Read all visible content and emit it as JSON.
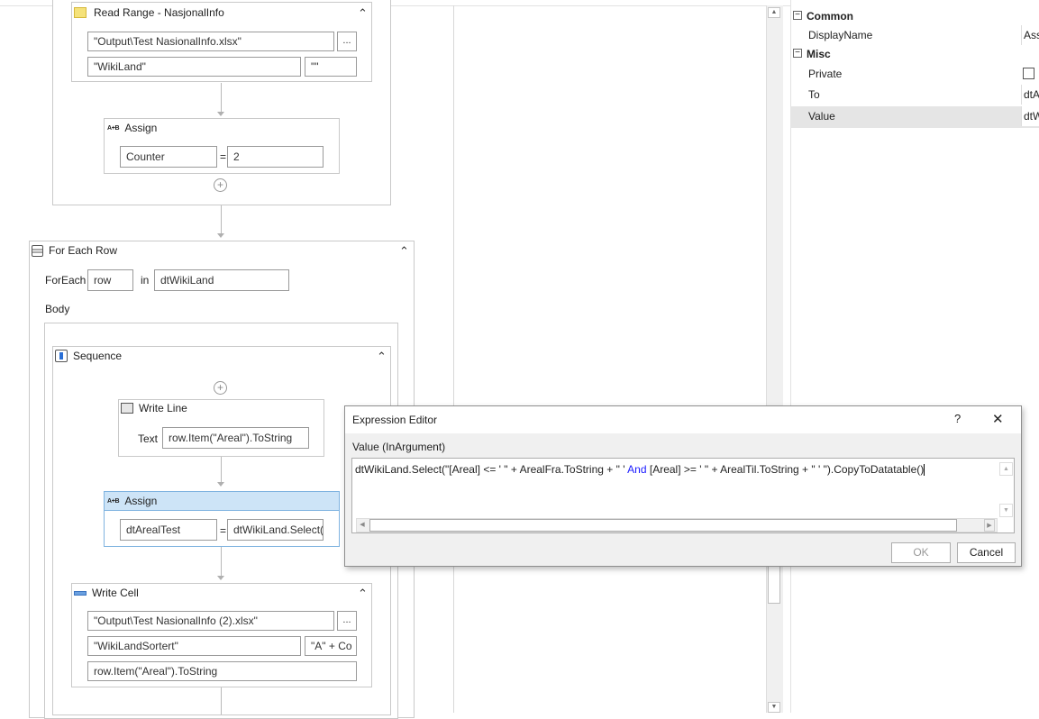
{
  "read_range": {
    "title": "Read Range - NasjonalInfo",
    "file": "\"Output\\Test NasionalInfo.xlsx\"",
    "browse": "...",
    "sheet": "\"WikiLand\"",
    "range": "\"\""
  },
  "assign1": {
    "icon": "A+B",
    "title": "Assign",
    "to": "Counter",
    "eq": "=",
    "value": "2"
  },
  "foreach": {
    "title": "For Each Row",
    "foreach_label": "ForEach",
    "var": "row",
    "in_label": "in",
    "collection": "dtWikiLand",
    "body_label": "Body"
  },
  "sequence": {
    "title": "Sequence"
  },
  "write_line": {
    "title": "Write Line",
    "text_label": "Text",
    "text": "row.Item(\"Areal\").ToString"
  },
  "assign2": {
    "icon": "A+B",
    "title": "Assign",
    "to": "dtArealTest",
    "eq": "=",
    "value": "dtWikiLand.Select("
  },
  "write_cell": {
    "title": "Write Cell",
    "file": "\"Output\\Test NasionalInfo (2).xlsx\"",
    "browse": "...",
    "sheet": "\"WikiLandSortert\"",
    "cell": "\"A\" + Co",
    "value": "row.Item(\"Areal\").ToString"
  },
  "properties": {
    "common_label": "Common",
    "displayname_label": "DisplayName",
    "displayname_value": "Assi",
    "misc_label": "Misc",
    "private_label": "Private",
    "to_label": "To",
    "to_value": "dtA",
    "value_label": "Value",
    "value_value": "dtW"
  },
  "dialog": {
    "title": "Expression Editor",
    "help": "?",
    "close": "✕",
    "subtitle": "Value (InArgument)",
    "expr_part1": "dtWikiLand.Select(\"[Areal] <= ' \" + ArealFra.ToString + \" ' ",
    "expr_keyword": "And",
    "expr_part2": " [Areal] >= ' \" + ArealTil.ToString + \" ' \").CopyToDatatable()",
    "ok": "OK",
    "cancel": "Cancel"
  },
  "colors": {
    "selected_bg": "#cde4f7",
    "keyword": "#1a1aff",
    "accent": "#7fb3e0"
  }
}
